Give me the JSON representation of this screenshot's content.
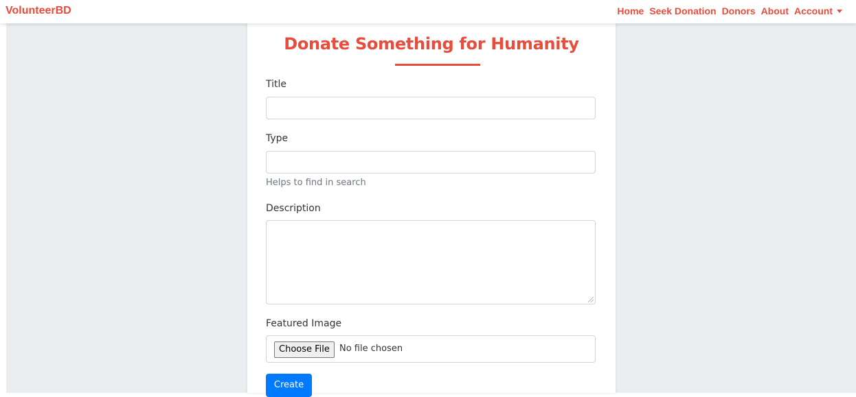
{
  "navbar": {
    "brand": "VolunteerBD",
    "links": [
      {
        "label": "Home"
      },
      {
        "label": "Seek Donation"
      },
      {
        "label": "Donors"
      },
      {
        "label": "About"
      },
      {
        "label": "Account"
      }
    ],
    "accent_color": "#e74c3c"
  },
  "form": {
    "title": "Donate Something for Humanity",
    "fields": {
      "title": {
        "label": "Title",
        "value": "",
        "placeholder": ""
      },
      "type": {
        "label": "Type",
        "value": "",
        "placeholder": "",
        "help": "Helps to find in search"
      },
      "description": {
        "label": "Description",
        "value": "",
        "placeholder": ""
      },
      "featured_image": {
        "label": "Featured Image",
        "button_label": "Choose File",
        "status": "No file chosen"
      }
    },
    "submit_label": "Create",
    "submit_color": "#007bff"
  }
}
